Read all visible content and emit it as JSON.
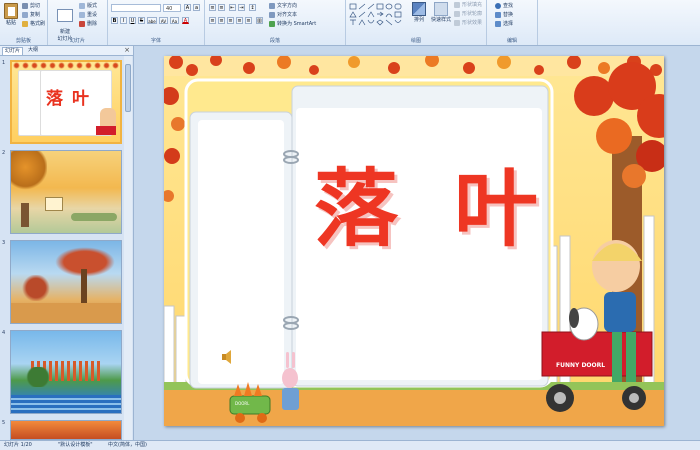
{
  "ribbon": {
    "clipboard": {
      "paste": "粘贴",
      "cut": "剪切",
      "copy": "复制",
      "format_painter": "格式刷",
      "label": "剪贴板"
    },
    "slides": {
      "new_slide": "新建\n幻灯片",
      "layout": "版式",
      "reset": "重设",
      "delete": "删除",
      "label": "幻灯片"
    },
    "font": {
      "font_name": "",
      "font_size": "40",
      "label": "字体",
      "bold": "B",
      "italic": "I",
      "underline": "U",
      "strike": "S",
      "shadow": "abe",
      "spacing": "AV",
      "case": "Aa",
      "color": "A"
    },
    "paragraph": {
      "text_direction": "文字方向",
      "align_text": "对齐文本",
      "convert_smartart": "转换为 SmartArt",
      "label": "段落"
    },
    "drawing": {
      "arrange": "排列",
      "quick_styles": "快速样式",
      "shape_fill": "形状填充",
      "shape_outline": "形状轮廓",
      "shape_effects": "形状效果",
      "label": "绘图"
    },
    "editing": {
      "find": "查找",
      "replace": "替换",
      "select": "选择",
      "label": "编辑"
    }
  },
  "panel": {
    "tab_slides": "幻灯片",
    "tab_outline": "大纲",
    "close": "×",
    "slide_numbers": [
      "1",
      "2",
      "3",
      "4",
      "5"
    ]
  },
  "slide": {
    "title": "落叶",
    "cart_text": "FUNNY DOORL",
    "bag_text": "DOORL"
  },
  "status": {
    "slide_position": "幻灯片 1/20",
    "theme": "\"默认设计模板\"",
    "language": "中文(简体，中国)"
  },
  "colors": {
    "title_red": "#ee3623",
    "thumb_selected_border": "#f1b341",
    "ribbon_bg": "#dde9f7"
  }
}
